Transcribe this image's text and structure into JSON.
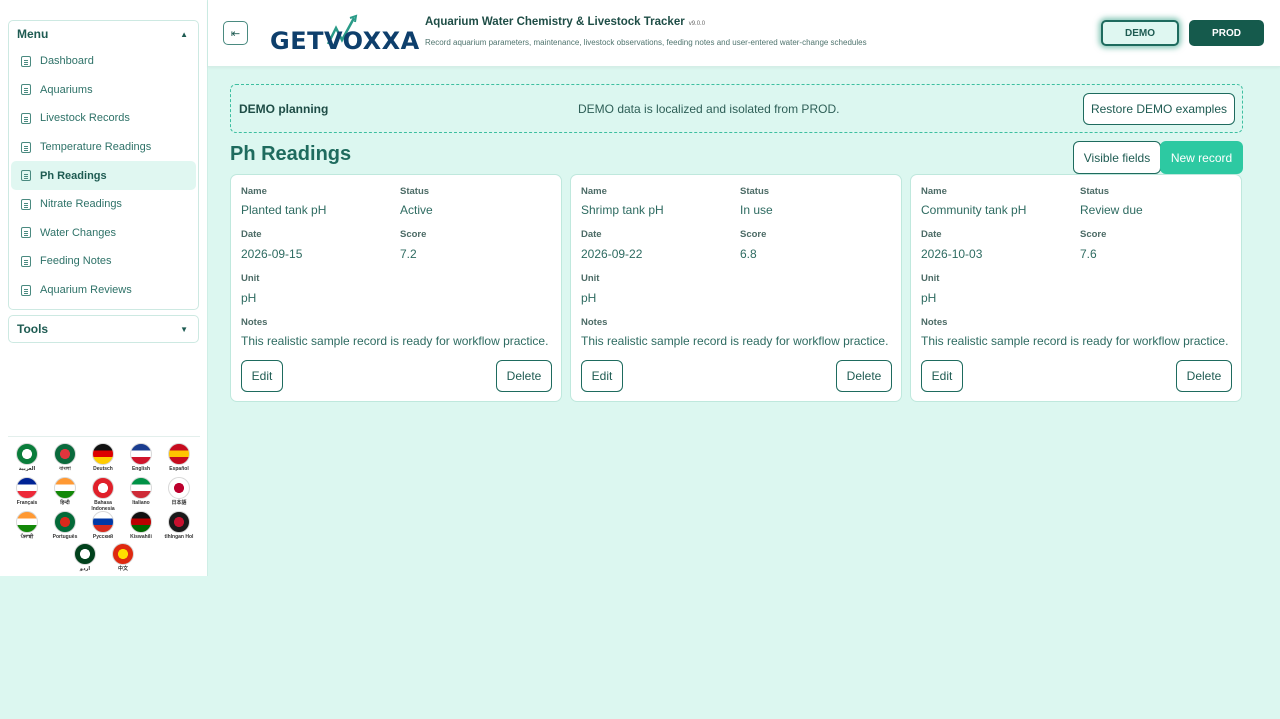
{
  "sidebar": {
    "menu_title": "Menu",
    "items": [
      {
        "label": "Dashboard"
      },
      {
        "label": "Aquariums"
      },
      {
        "label": "Livestock Records"
      },
      {
        "label": "Temperature Readings"
      },
      {
        "label": "Ph Readings"
      },
      {
        "label": "Nitrate Readings"
      },
      {
        "label": "Water Changes"
      },
      {
        "label": "Feeding Notes"
      },
      {
        "label": "Aquarium Reviews"
      }
    ],
    "active_item": "Ph Readings",
    "tools_title": "Tools",
    "languages": [
      {
        "label": "العربية",
        "colors": [
          "#0a7d3b",
          "#ffffff"
        ]
      },
      {
        "label": "বাংলা",
        "colors": [
          "#0a6a3c",
          "#e0343d"
        ]
      },
      {
        "label": "Deutsch",
        "colors": [
          "#111111",
          "#dd0000",
          "#ffcc00"
        ]
      },
      {
        "label": "English",
        "colors": [
          "#1a3c8f",
          "#ffffff",
          "#cf142b"
        ]
      },
      {
        "label": "Español",
        "colors": [
          "#c60b1e",
          "#ffc400",
          "#c60b1e"
        ]
      },
      {
        "label": "Français",
        "colors": [
          "#002395",
          "#ffffff",
          "#ed2939"
        ]
      },
      {
        "label": "हिन्दी",
        "colors": [
          "#ff9933",
          "#ffffff",
          "#138808"
        ]
      },
      {
        "label": "Bahasa Indonesia",
        "colors": [
          "#e0202a",
          "#ffffff"
        ]
      },
      {
        "label": "Italiano",
        "colors": [
          "#009246",
          "#ffffff",
          "#ce2b37"
        ]
      },
      {
        "label": "日本語",
        "colors": [
          "#ffffff",
          "#bc002d"
        ]
      },
      {
        "label": "ਪੰਜਾਬੀ",
        "colors": [
          "#ff9933",
          "#ffffff",
          "#138808"
        ]
      },
      {
        "label": "Português",
        "colors": [
          "#046a38",
          "#da291c"
        ]
      },
      {
        "label": "Русский",
        "colors": [
          "#ffffff",
          "#0039a6",
          "#d52b1e"
        ]
      },
      {
        "label": "Kiswahili",
        "colors": [
          "#111111",
          "#bb0000",
          "#006600"
        ]
      },
      {
        "label": "tlhIngan Hol",
        "colors": [
          "#1a1a1a",
          "#c8102e"
        ]
      },
      {
        "label": "اردو",
        "colors": [
          "#01411c",
          "#ffffff"
        ]
      },
      {
        "label": "中文",
        "colors": [
          "#de2910",
          "#ffde00"
        ]
      }
    ]
  },
  "header": {
    "logo_text": "GETVOXXA",
    "title": "Aquarium Water Chemistry & Livestock Tracker",
    "version": "v9.0.0",
    "subtitle": "Record aquarium parameters, maintenance, livestock observations, feeding notes and user-entered water-change schedules",
    "demo_label": "DEMO",
    "prod_label": "PROD"
  },
  "banner": {
    "title": "DEMO planning",
    "message": "DEMO data is localized and isolated from PROD.",
    "restore_label": "Restore DEMO examples"
  },
  "page": {
    "title": "Ph Readings",
    "visible_fields_label": "Visible fields",
    "new_record_label": "New record"
  },
  "field_labels": {
    "name": "Name",
    "status": "Status",
    "date": "Date",
    "score": "Score",
    "unit": "Unit",
    "notes": "Notes"
  },
  "actions": {
    "edit": "Edit",
    "delete": "Delete"
  },
  "cards": [
    {
      "name": "Planted tank pH",
      "status": "Active",
      "date": "2026-09-15",
      "score": "7.2",
      "unit": "pH",
      "notes": "This realistic sample record is ready for workflow practice."
    },
    {
      "name": "Shrimp tank pH",
      "status": "In use",
      "date": "2026-09-22",
      "score": "6.8",
      "unit": "pH",
      "notes": "This realistic sample record is ready for workflow practice."
    },
    {
      "name": "Community tank pH",
      "status": "Review due",
      "date": "2026-10-03",
      "score": "7.6",
      "unit": "pH",
      "notes": "This realistic sample record is ready for workflow practice."
    }
  ],
  "colors": {
    "accent": "#2dc9a2",
    "dark_green": "#155a4c",
    "background": "#dcf7f0"
  }
}
